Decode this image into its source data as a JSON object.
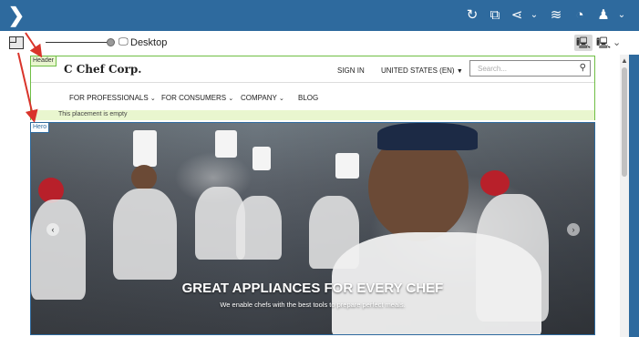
{
  "toolbar": {
    "viewport_label": "Desktop"
  },
  "site_header": {
    "zone_label": "Header",
    "logo_text": "Chef Corp.",
    "sign_in": "SIGN IN",
    "locale": "UNITED STATES (EN)",
    "search_placeholder": "Search...",
    "nav": {
      "professionals": "FOR PROFESSIONALS",
      "consumers": "FOR CONSUMERS",
      "company": "COMPANY",
      "blog": "BLOG"
    },
    "empty_placement": "This placement is empty"
  },
  "hero": {
    "zone_label": "Hero",
    "title": "GREAT APPLIANCES FOR EVERY CHEF",
    "subtitle": "We enable chefs with the best tools to prepare perfect meals."
  },
  "colors": {
    "topbar": "#2e6a9e",
    "header_zone": "#6fbe45",
    "hero_zone": "#2e6a9e",
    "annotation_arrow": "#d9342b"
  }
}
